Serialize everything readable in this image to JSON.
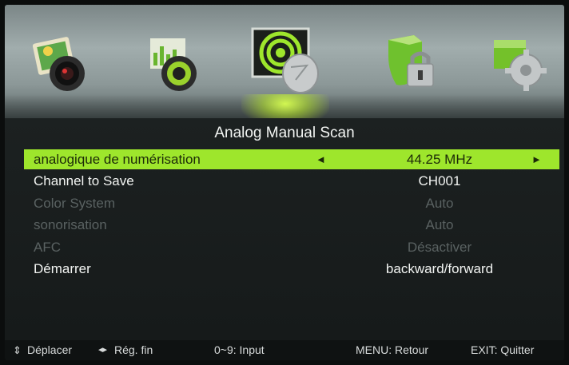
{
  "icons": [
    {
      "name": "picture-icon"
    },
    {
      "name": "sound-icon"
    },
    {
      "name": "channel-icon",
      "selected": true
    },
    {
      "name": "lock-icon"
    },
    {
      "name": "setup-icon"
    }
  ],
  "menu": {
    "title": "Analog Manual Scan",
    "rows": [
      {
        "label": "analogique de numérisation",
        "value": "44.25 MHz",
        "state": "active",
        "arrow_left": "◄",
        "arrow_right": "►"
      },
      {
        "label": "Channel to Save",
        "value": "CH001",
        "state": "normal"
      },
      {
        "label": "Color System",
        "value": "Auto",
        "state": "disabled"
      },
      {
        "label": "sonorisation",
        "value": "Auto",
        "state": "disabled"
      },
      {
        "label": "AFC",
        "value": "Désactiver",
        "state": "disabled"
      },
      {
        "label": "Démarrer",
        "value": "backward/forward",
        "state": "normal"
      }
    ]
  },
  "footer": {
    "move": "Déplacer",
    "fine": "Rég. fin",
    "input": "0~9: Input",
    "menu": "MENU: Retour",
    "exit": "EXIT: Quitter",
    "move_symbol": "⇕",
    "fine_symbol": "◂▸"
  },
  "colors": {
    "highlight": "#9ee62c",
    "text": "#f2f4f2",
    "disabled_text": "#5a6262"
  }
}
